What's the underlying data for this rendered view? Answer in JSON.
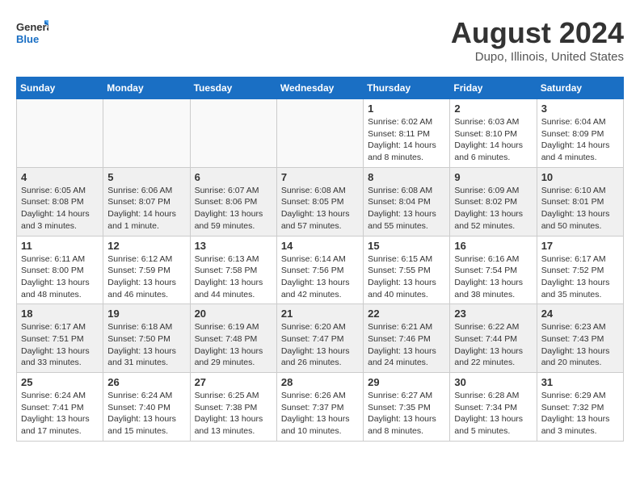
{
  "header": {
    "logo_line1": "General",
    "logo_line2": "Blue",
    "month": "August 2024",
    "location": "Dupo, Illinois, United States"
  },
  "days_of_week": [
    "Sunday",
    "Monday",
    "Tuesday",
    "Wednesday",
    "Thursday",
    "Friday",
    "Saturday"
  ],
  "weeks": [
    {
      "alt": false,
      "days": [
        {
          "num": "",
          "text": "",
          "empty": true
        },
        {
          "num": "",
          "text": "",
          "empty": true
        },
        {
          "num": "",
          "text": "",
          "empty": true
        },
        {
          "num": "",
          "text": "",
          "empty": true
        },
        {
          "num": "1",
          "text": "Sunrise: 6:02 AM\nSunset: 8:11 PM\nDaylight: 14 hours\nand 8 minutes.",
          "empty": false
        },
        {
          "num": "2",
          "text": "Sunrise: 6:03 AM\nSunset: 8:10 PM\nDaylight: 14 hours\nand 6 minutes.",
          "empty": false
        },
        {
          "num": "3",
          "text": "Sunrise: 6:04 AM\nSunset: 8:09 PM\nDaylight: 14 hours\nand 4 minutes.",
          "empty": false
        }
      ]
    },
    {
      "alt": true,
      "days": [
        {
          "num": "4",
          "text": "Sunrise: 6:05 AM\nSunset: 8:08 PM\nDaylight: 14 hours\nand 3 minutes.",
          "empty": false
        },
        {
          "num": "5",
          "text": "Sunrise: 6:06 AM\nSunset: 8:07 PM\nDaylight: 14 hours\nand 1 minute.",
          "empty": false
        },
        {
          "num": "6",
          "text": "Sunrise: 6:07 AM\nSunset: 8:06 PM\nDaylight: 13 hours\nand 59 minutes.",
          "empty": false
        },
        {
          "num": "7",
          "text": "Sunrise: 6:08 AM\nSunset: 8:05 PM\nDaylight: 13 hours\nand 57 minutes.",
          "empty": false
        },
        {
          "num": "8",
          "text": "Sunrise: 6:08 AM\nSunset: 8:04 PM\nDaylight: 13 hours\nand 55 minutes.",
          "empty": false
        },
        {
          "num": "9",
          "text": "Sunrise: 6:09 AM\nSunset: 8:02 PM\nDaylight: 13 hours\nand 52 minutes.",
          "empty": false
        },
        {
          "num": "10",
          "text": "Sunrise: 6:10 AM\nSunset: 8:01 PM\nDaylight: 13 hours\nand 50 minutes.",
          "empty": false
        }
      ]
    },
    {
      "alt": false,
      "days": [
        {
          "num": "11",
          "text": "Sunrise: 6:11 AM\nSunset: 8:00 PM\nDaylight: 13 hours\nand 48 minutes.",
          "empty": false
        },
        {
          "num": "12",
          "text": "Sunrise: 6:12 AM\nSunset: 7:59 PM\nDaylight: 13 hours\nand 46 minutes.",
          "empty": false
        },
        {
          "num": "13",
          "text": "Sunrise: 6:13 AM\nSunset: 7:58 PM\nDaylight: 13 hours\nand 44 minutes.",
          "empty": false
        },
        {
          "num": "14",
          "text": "Sunrise: 6:14 AM\nSunset: 7:56 PM\nDaylight: 13 hours\nand 42 minutes.",
          "empty": false
        },
        {
          "num": "15",
          "text": "Sunrise: 6:15 AM\nSunset: 7:55 PM\nDaylight: 13 hours\nand 40 minutes.",
          "empty": false
        },
        {
          "num": "16",
          "text": "Sunrise: 6:16 AM\nSunset: 7:54 PM\nDaylight: 13 hours\nand 38 minutes.",
          "empty": false
        },
        {
          "num": "17",
          "text": "Sunrise: 6:17 AM\nSunset: 7:52 PM\nDaylight: 13 hours\nand 35 minutes.",
          "empty": false
        }
      ]
    },
    {
      "alt": true,
      "days": [
        {
          "num": "18",
          "text": "Sunrise: 6:17 AM\nSunset: 7:51 PM\nDaylight: 13 hours\nand 33 minutes.",
          "empty": false
        },
        {
          "num": "19",
          "text": "Sunrise: 6:18 AM\nSunset: 7:50 PM\nDaylight: 13 hours\nand 31 minutes.",
          "empty": false
        },
        {
          "num": "20",
          "text": "Sunrise: 6:19 AM\nSunset: 7:48 PM\nDaylight: 13 hours\nand 29 minutes.",
          "empty": false
        },
        {
          "num": "21",
          "text": "Sunrise: 6:20 AM\nSunset: 7:47 PM\nDaylight: 13 hours\nand 26 minutes.",
          "empty": false
        },
        {
          "num": "22",
          "text": "Sunrise: 6:21 AM\nSunset: 7:46 PM\nDaylight: 13 hours\nand 24 minutes.",
          "empty": false
        },
        {
          "num": "23",
          "text": "Sunrise: 6:22 AM\nSunset: 7:44 PM\nDaylight: 13 hours\nand 22 minutes.",
          "empty": false
        },
        {
          "num": "24",
          "text": "Sunrise: 6:23 AM\nSunset: 7:43 PM\nDaylight: 13 hours\nand 20 minutes.",
          "empty": false
        }
      ]
    },
    {
      "alt": false,
      "days": [
        {
          "num": "25",
          "text": "Sunrise: 6:24 AM\nSunset: 7:41 PM\nDaylight: 13 hours\nand 17 minutes.",
          "empty": false
        },
        {
          "num": "26",
          "text": "Sunrise: 6:24 AM\nSunset: 7:40 PM\nDaylight: 13 hours\nand 15 minutes.",
          "empty": false
        },
        {
          "num": "27",
          "text": "Sunrise: 6:25 AM\nSunset: 7:38 PM\nDaylight: 13 hours\nand 13 minutes.",
          "empty": false
        },
        {
          "num": "28",
          "text": "Sunrise: 6:26 AM\nSunset: 7:37 PM\nDaylight: 13 hours\nand 10 minutes.",
          "empty": false
        },
        {
          "num": "29",
          "text": "Sunrise: 6:27 AM\nSunset: 7:35 PM\nDaylight: 13 hours\nand 8 minutes.",
          "empty": false
        },
        {
          "num": "30",
          "text": "Sunrise: 6:28 AM\nSunset: 7:34 PM\nDaylight: 13 hours\nand 5 minutes.",
          "empty": false
        },
        {
          "num": "31",
          "text": "Sunrise: 6:29 AM\nSunset: 7:32 PM\nDaylight: 13 hours\nand 3 minutes.",
          "empty": false
        }
      ]
    }
  ]
}
